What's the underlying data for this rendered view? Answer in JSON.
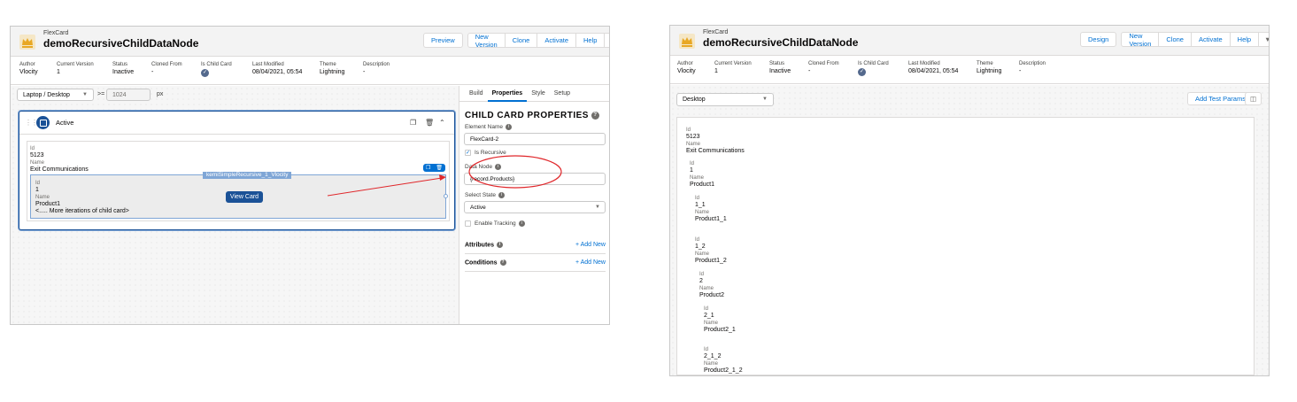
{
  "left": {
    "header": {
      "object_type": "FlexCard",
      "title": "demoRecursiveChildDataNode",
      "preview_label": "Preview",
      "buttons": [
        "New Version",
        "Clone",
        "Activate",
        "Help"
      ]
    },
    "meta": [
      {
        "label": "Author",
        "value": "Vlocity"
      },
      {
        "label": "Current Version",
        "value": "1"
      },
      {
        "label": "Status",
        "value": "Inactive"
      },
      {
        "label": "Cloned From",
        "value": "-"
      },
      {
        "label": "Is Child Card",
        "value": ""
      },
      {
        "label": "Last Modified",
        "value": "08/04/2021, 05:54"
      },
      {
        "label": "Theme",
        "value": "Lightning"
      },
      {
        "label": "Description",
        "value": "-"
      }
    ],
    "toolbar": {
      "device": "Laptop / Desktop",
      "operator": ">=",
      "width_value": "1024",
      "unit": "px"
    },
    "card": {
      "state_label": "Active",
      "fields": {
        "id_label": "Id",
        "id_value": "5123",
        "name_label": "Name",
        "name_value": "Exit Communications"
      },
      "child": {
        "tag": "kemiSimpleRecursive_1_Vlocity",
        "id_label": "Id",
        "id_value": "1",
        "name_label": "Name",
        "name_value": "Product1",
        "more_text": "<..... More iterations of child card>",
        "view_card_label": "View Card"
      }
    },
    "properties": {
      "tabs": [
        "Build",
        "Properties",
        "Style",
        "Setup"
      ],
      "active_tab": "Properties",
      "title": "CHILD CARD PROPERTIES",
      "element_name_label": "Element Name",
      "element_name_value": "FlexCard-2",
      "is_recursive_label": "Is Recursive",
      "data_node_label": "Data Node",
      "data_node_value": "{record.Products}",
      "select_state_label": "Select State",
      "select_state_value": "Active",
      "enable_tracking_label": "Enable Tracking",
      "attributes_label": "Attributes",
      "conditions_label": "Conditions",
      "add_new_label": "+ Add New"
    },
    "colors": {
      "annotation": "#e0272b",
      "brand": "#1b5297",
      "link": "#0070d2"
    }
  },
  "right": {
    "header": {
      "object_type": "FlexCard",
      "title": "demoRecursiveChildDataNode",
      "design_label": "Design",
      "buttons": [
        "New Version",
        "Clone",
        "Activate",
        "Help"
      ]
    },
    "meta": [
      {
        "label": "Author",
        "value": "Vlocity"
      },
      {
        "label": "Current Version",
        "value": "1"
      },
      {
        "label": "Status",
        "value": "Inactive"
      },
      {
        "label": "Cloned From",
        "value": "-"
      },
      {
        "label": "Is Child Card",
        "value": ""
      },
      {
        "label": "Last Modified",
        "value": "08/04/2021, 05:54"
      },
      {
        "label": "Theme",
        "value": "Lightning"
      },
      {
        "label": "Description",
        "value": "-"
      }
    ],
    "device": "Desktop",
    "add_test_params_label": "Add Test Params",
    "nodes": [
      {
        "id_label": "Id",
        "id": "5123",
        "name_label": "Name",
        "name": "Exit Communications"
      },
      {
        "id_label": "Id",
        "id": "1",
        "name_label": "Name",
        "name": "Product1"
      },
      {
        "id_label": "Id",
        "id": "1_1",
        "name_label": "Name",
        "name": "Product1_1"
      },
      {
        "id_label": "Id",
        "id": "1_2",
        "name_label": "Name",
        "name": "Product1_2"
      },
      {
        "id_label": "Id",
        "id": "2",
        "name_label": "Name",
        "name": "Product2"
      },
      {
        "id_label": "Id",
        "id": "2_1",
        "name_label": "Name",
        "name": "Product2_1"
      },
      {
        "id_label": "Id",
        "id": "2_1_2",
        "name_label": "Name",
        "name": "Product2_1_2"
      }
    ]
  }
}
